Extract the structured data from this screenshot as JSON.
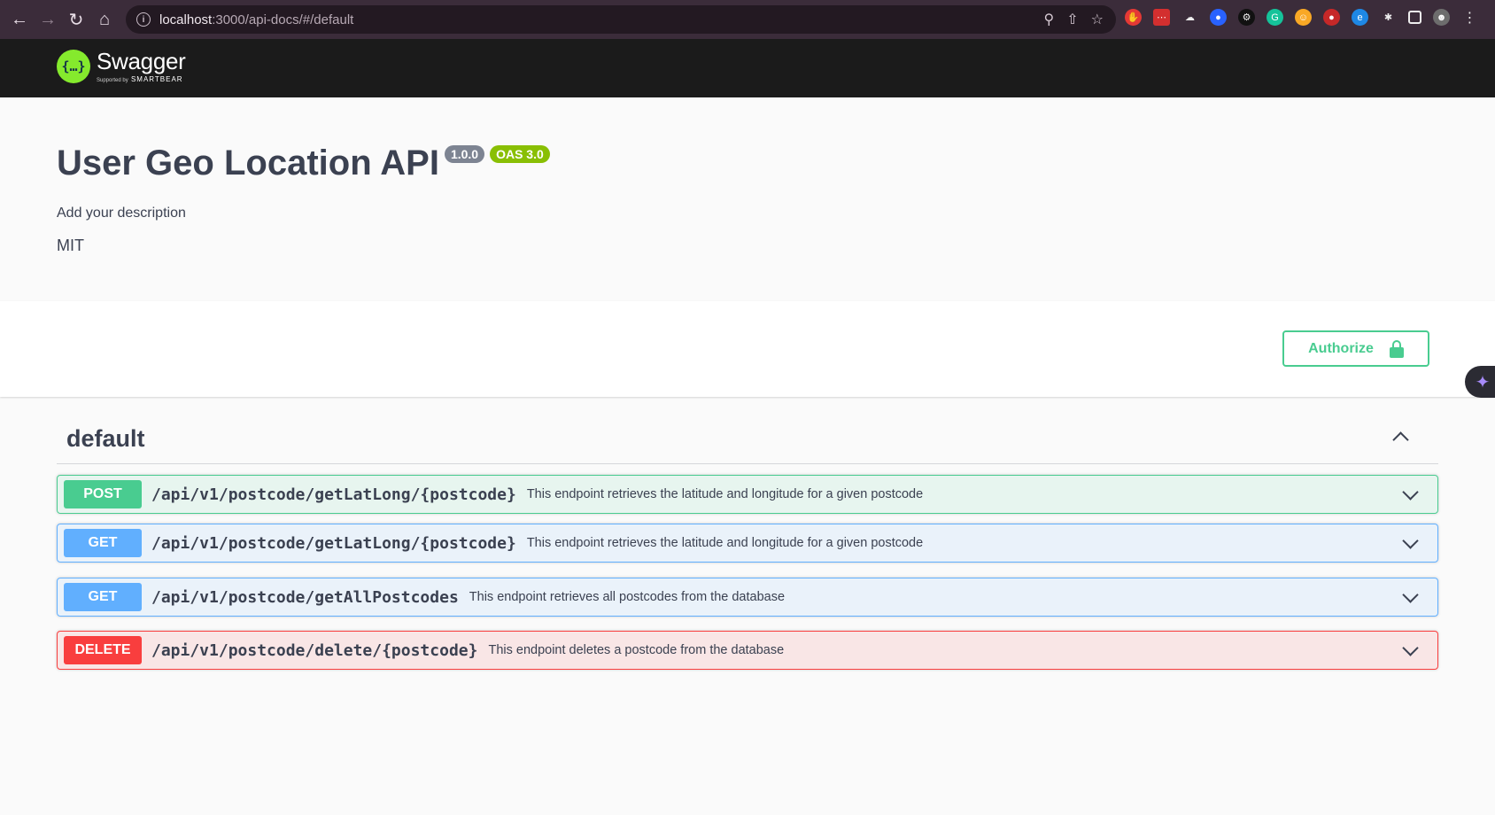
{
  "browser": {
    "url_host": "localhost",
    "url_rest": ":3000/api-docs/#/default"
  },
  "swagger": {
    "logo_name": "Swagger",
    "logo_supported": "Supported by",
    "logo_brand": "SMARTBEAR"
  },
  "info": {
    "title": "User Geo Location API",
    "version": "1.0.0",
    "oas": "OAS 3.0",
    "description": "Add your description",
    "license": "MIT"
  },
  "authorize": {
    "label": "Authorize"
  },
  "tag": {
    "name": "default"
  },
  "operations": [
    {
      "method": "POST",
      "path": "/api/v1/postcode/getLatLong/{postcode}",
      "summary": "This endpoint retrieves the latitude and longitude for a given postcode"
    },
    {
      "method": "GET",
      "path": "/api/v1/postcode/getLatLong/{postcode}",
      "summary": "This endpoint retrieves the latitude and longitude for a given postcode"
    },
    {
      "method": "GET",
      "path": "/api/v1/postcode/getAllPostcodes",
      "summary": "This endpoint retrieves all postcodes from the database"
    },
    {
      "method": "DELETE",
      "path": "/api/v1/postcode/delete/{postcode}",
      "summary": "This endpoint deletes a postcode from the database"
    }
  ],
  "colors": {
    "post": "#49cc90",
    "get": "#61affe",
    "delete": "#f93e3e",
    "swagger_green": "#85ea2d",
    "topbar": "#1b1b1b"
  }
}
